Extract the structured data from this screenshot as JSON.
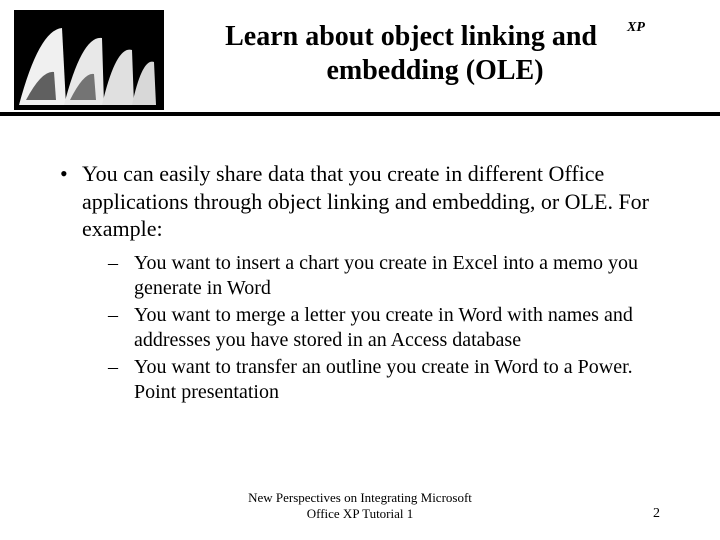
{
  "header": {
    "xp_label": "XP",
    "title_line1": "Learn about object linking and",
    "title_line2": "embedding (OLE)"
  },
  "content": {
    "main_bullet": "You can easily share data that you create in different Office applications through object linking and embedding, or OLE. For example:",
    "sub_bullets": [
      "You want to insert a chart you create in Excel into a memo you generate in Word",
      "You want to merge a letter you create in Word with names and addresses you have stored in an Access database",
      "You want to transfer an outline you create in Word to a Power. Point presentation"
    ]
  },
  "footer": {
    "text_line1": "New Perspectives on Integrating Microsoft",
    "text_line2": "Office XP Tutorial 1",
    "page_number": "2"
  }
}
